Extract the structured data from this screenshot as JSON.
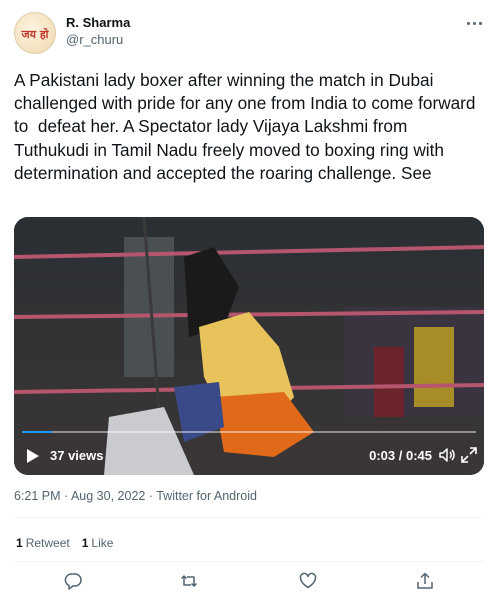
{
  "user": {
    "name": "R. Sharma",
    "handle": "@r_churu",
    "avatar_text": "जय हो"
  },
  "tweet": {
    "text": "A Pakistani lady boxer after winning the match in Dubai challenged with pride for any one from India to come forward to  defeat her. A Spectator lady Vijaya Lakshmi from Tuthukudi in Tamil Nadu freely moved to boxing ring with determination and accepted the roaring challenge. See"
  },
  "video": {
    "views": "37 views",
    "time": "0:03 / 0:45",
    "progress": 0.067
  },
  "meta": {
    "timestamp": "6:21 PM · Aug 30, 2022",
    "separator": " · ",
    "source": "Twitter for Android"
  },
  "stats": {
    "retweets_count": "1",
    "retweets_label": "Retweet",
    "likes_count": "1",
    "likes_label": "Like"
  },
  "colors": {
    "accent": "#1d9bf0",
    "text": "#0f1419",
    "secondary": "#536471"
  }
}
